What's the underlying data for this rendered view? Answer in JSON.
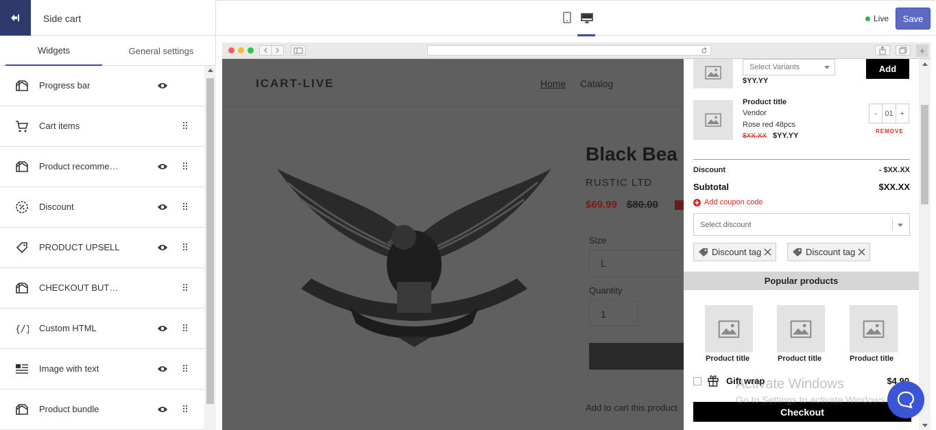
{
  "left_panel": {
    "title": "Side cart",
    "tabs": [
      "Widgets",
      "General settings"
    ],
    "widgets": [
      {
        "label": "Progress bar",
        "icon": "tent-icon",
        "eye": true,
        "drag": false
      },
      {
        "label": "Cart items",
        "icon": "cart-icon",
        "eye": false,
        "drag": true
      },
      {
        "label": "Product recommen...",
        "icon": "tent-icon",
        "eye": true,
        "drag": true
      },
      {
        "label": "Discount",
        "icon": "percent-badge-icon",
        "eye": true,
        "drag": true
      },
      {
        "label": "PRODUCT UPSELL",
        "icon": "tag-icon",
        "eye": true,
        "drag": true
      },
      {
        "label": "CHECKOUT BUTTON",
        "icon": "tent-icon",
        "eye": false,
        "drag": true
      },
      {
        "label": "Custom HTML",
        "icon": "code-icon",
        "eye": true,
        "drag": true
      },
      {
        "label": "Image with text",
        "icon": "image-text-icon",
        "eye": true,
        "drag": true
      },
      {
        "label": "Product bundle",
        "icon": "tent-icon",
        "eye": true,
        "drag": true
      }
    ]
  },
  "topbar": {
    "status": "Live",
    "save_label": "Save"
  },
  "store": {
    "brand": "ICART-LIVE",
    "nav": [
      "Home",
      "Catalog"
    ],
    "product_title": "Black Bea",
    "vendor": "RUSTIC LTD",
    "price": "$69.99",
    "old_price": "$80.00",
    "size_label": "Size",
    "size_value": "L",
    "quantity_label": "Quantity",
    "quantity_value": "1",
    "add_text": "Add to cart this product."
  },
  "cart": {
    "upsell": {
      "select_placeholder": "Select Variants",
      "price": "$YY.YY",
      "add_label": "Add"
    },
    "item": {
      "title": "Product title",
      "vendor": "Vendor",
      "variant": "Rose red 48pcs",
      "old_price": "$XX.XX",
      "price": "$YY.YY",
      "qty_minus": "-",
      "qty": "01",
      "qty_plus": "+",
      "remove": "REMOVE"
    },
    "discount_label": "Discount",
    "discount_value": "- $XX.XX",
    "subtotal_label": "Subtotal",
    "subtotal_value": "$XX.XX",
    "coupon_link": "Add coupon code",
    "discount_select": "Select discount",
    "discount_tags": [
      "Discount tag",
      "Discount tag"
    ],
    "popular_title": "Popular products",
    "popular_items": [
      "Product title",
      "Product title",
      "Product title"
    ],
    "gift_label": "Gift wrap",
    "gift_price": "$4.90",
    "checkout_label": "Checkout"
  },
  "overlay": {
    "watermark_title": "Activate Windows",
    "watermark_sub": "Go to Settings to activate Windows."
  },
  "colors": {
    "accent": "#5c6ac4",
    "sidebar_dark": "#2e3a6b",
    "live_dot": "#27ae60",
    "remove_red": "#e02020"
  }
}
